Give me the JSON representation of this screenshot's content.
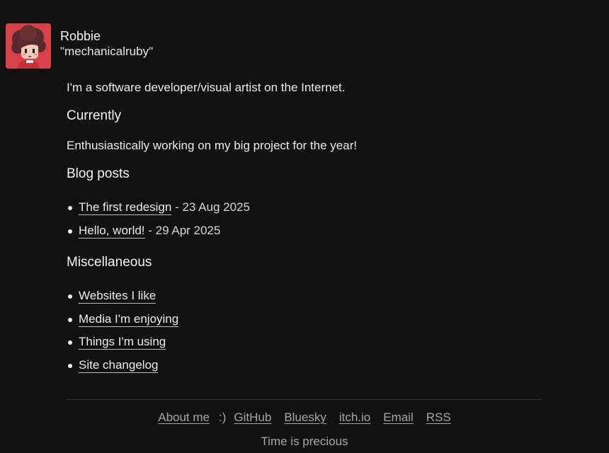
{
  "profile": {
    "name": "Robbie",
    "handle": "\"mechanicalruby\""
  },
  "intro": "I'm a software developer/visual artist on the Internet.",
  "currently": {
    "heading": "Currently",
    "text": "Enthusiastically working on my big project for the year!"
  },
  "blog": {
    "heading": "Blog posts",
    "posts": [
      {
        "title": "The first redesign",
        "date": " - 23 Aug 2025"
      },
      {
        "title": "Hello, world!",
        "date": " - 29 Apr 2025"
      }
    ]
  },
  "misc": {
    "heading": "Miscellaneous",
    "items": [
      "Websites I like",
      "Media I'm enjoying",
      "Things I'm using",
      "Site changelog"
    ]
  },
  "footer": {
    "about": "About me",
    "smile": ":)",
    "links": [
      "GitHub",
      "Bluesky",
      "itch.io",
      "Email",
      "RSS"
    ],
    "tagline": "Time is precious"
  },
  "colors": {
    "background": "#111111",
    "text": "#ececec",
    "muted": "#a6a6a6",
    "avatar_bg": "#d8404a"
  },
  "icons": {
    "avatar": "pixel-art-character-avatar"
  }
}
